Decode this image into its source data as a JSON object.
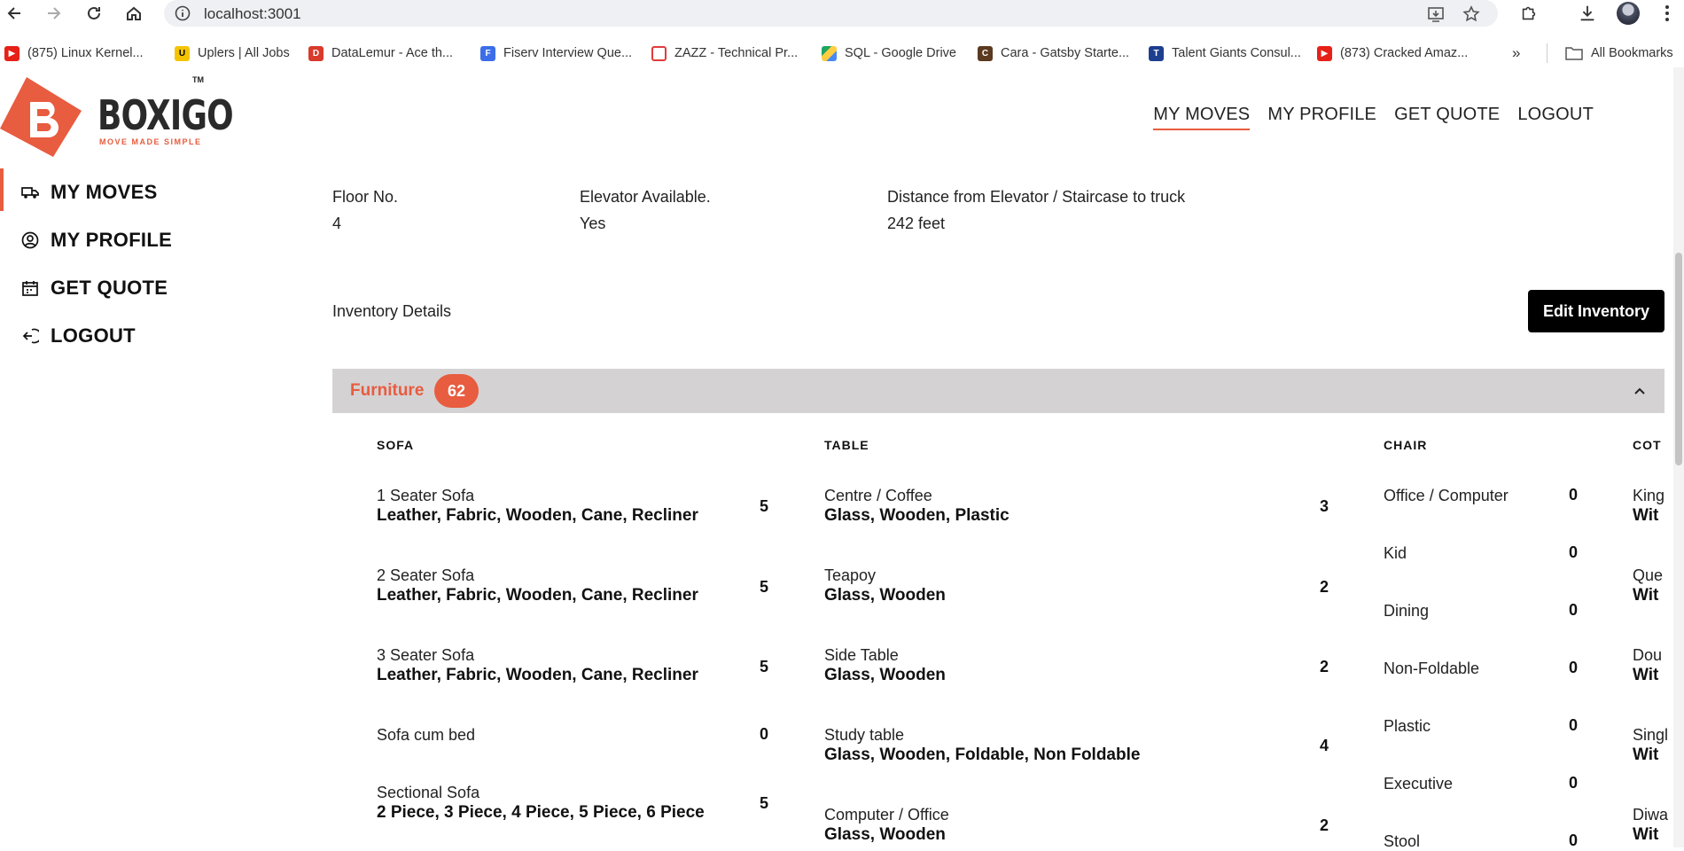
{
  "browser": {
    "url": "localhost:3001",
    "bookmarks": [
      {
        "label": "(875) Linux Kernel...",
        "color": "#e62117"
      },
      {
        "label": "Uplers | All Jobs",
        "color": "#f5c400"
      },
      {
        "label": "DataLemur - Ace th...",
        "color": "#d83a2c"
      },
      {
        "label": "Fiserv Interview Que...",
        "color": "#3b6ee8"
      },
      {
        "label": "ZAZZ - Technical Pr...",
        "color": "#e23b3b"
      },
      {
        "label": "SQL - Google Drive",
        "color": "#1fa463"
      },
      {
        "label": "Cara - Gatsby Starte...",
        "color": "#5b3a1f"
      },
      {
        "label": "Talent Giants Consul...",
        "color": "#1d3f8f"
      },
      {
        "label": "(873) Cracked Amaz...",
        "color": "#e62117"
      }
    ],
    "all_bookmarks": "All Bookmarks"
  },
  "brand": {
    "name": "BOXIGO",
    "tagline": "MOVE MADE SIMPLE",
    "tm": "TM",
    "accent": "#e85c3f"
  },
  "top_nav": [
    "MY MOVES",
    "MY PROFILE",
    "GET QUOTE",
    "LOGOUT"
  ],
  "side_nav": [
    {
      "label": "MY MOVES",
      "icon": "truck-icon"
    },
    {
      "label": "MY PROFILE",
      "icon": "user-circle-icon"
    },
    {
      "label": "GET QUOTE",
      "icon": "calendar-icon"
    },
    {
      "label": "LOGOUT",
      "icon": "logout-icon"
    }
  ],
  "details": {
    "floor_label": "Floor No.",
    "floor_value": "4",
    "elevator_label": "Elevator Available.",
    "elevator_value": "Yes",
    "distance_label": "Distance from Elevator / Staircase to truck",
    "distance_value": "242 feet"
  },
  "inventory": {
    "title": "Inventory Details",
    "edit_button": "Edit Inventory",
    "category": "Furniture",
    "category_count": "62",
    "columns": [
      {
        "heading": "SOFA",
        "items": [
          {
            "name": "1 Seater Sofa",
            "sub": "Leather, Fabric, Wooden, Cane, Recliner",
            "qty": "5"
          },
          {
            "name": "2 Seater Sofa",
            "sub": "Leather, Fabric, Wooden, Cane, Recliner",
            "qty": "5"
          },
          {
            "name": "3 Seater Sofa",
            "sub": "Leather, Fabric, Wooden, Cane, Recliner",
            "qty": "5"
          },
          {
            "name": "Sofa cum bed",
            "sub": "",
            "qty": "0"
          },
          {
            "name": "Sectional Sofa",
            "sub": "2 Piece, 3 Piece, 4 Piece, 5 Piece, 6 Piece",
            "qty": "5"
          }
        ]
      },
      {
        "heading": "TABLE",
        "items": [
          {
            "name": "Centre / Coffee",
            "sub": "Glass, Wooden, Plastic",
            "qty": "3"
          },
          {
            "name": "Teapoy",
            "sub": "Glass, Wooden",
            "qty": "2"
          },
          {
            "name": "Side Table",
            "sub": "Glass, Wooden",
            "qty": "2"
          },
          {
            "name": "Study table",
            "sub": "Glass, Wooden, Foldable, Non Foldable",
            "qty": "4"
          },
          {
            "name": "Computer / Office",
            "sub": "Glass, Wooden",
            "qty": "2"
          }
        ]
      },
      {
        "heading": "CHAIR",
        "items": [
          {
            "name": "Office / Computer",
            "qty": "0"
          },
          {
            "name": "Kid",
            "qty": "0"
          },
          {
            "name": "Dining",
            "qty": "0"
          },
          {
            "name": "Non-Foldable",
            "qty": "0"
          },
          {
            "name": "Plastic",
            "qty": "0"
          },
          {
            "name": "Executive",
            "qty": "0"
          },
          {
            "name": "Stool",
            "qty": "0"
          }
        ]
      },
      {
        "heading": "COT",
        "items": [
          {
            "name": "King",
            "sub": "Wit"
          },
          {
            "name": "Que",
            "sub": "Wit"
          },
          {
            "name": "Dou",
            "sub": "Wit"
          },
          {
            "name": "Singl",
            "sub": "Wit"
          },
          {
            "name": "Diwa",
            "sub": "Wit"
          }
        ]
      }
    ]
  }
}
